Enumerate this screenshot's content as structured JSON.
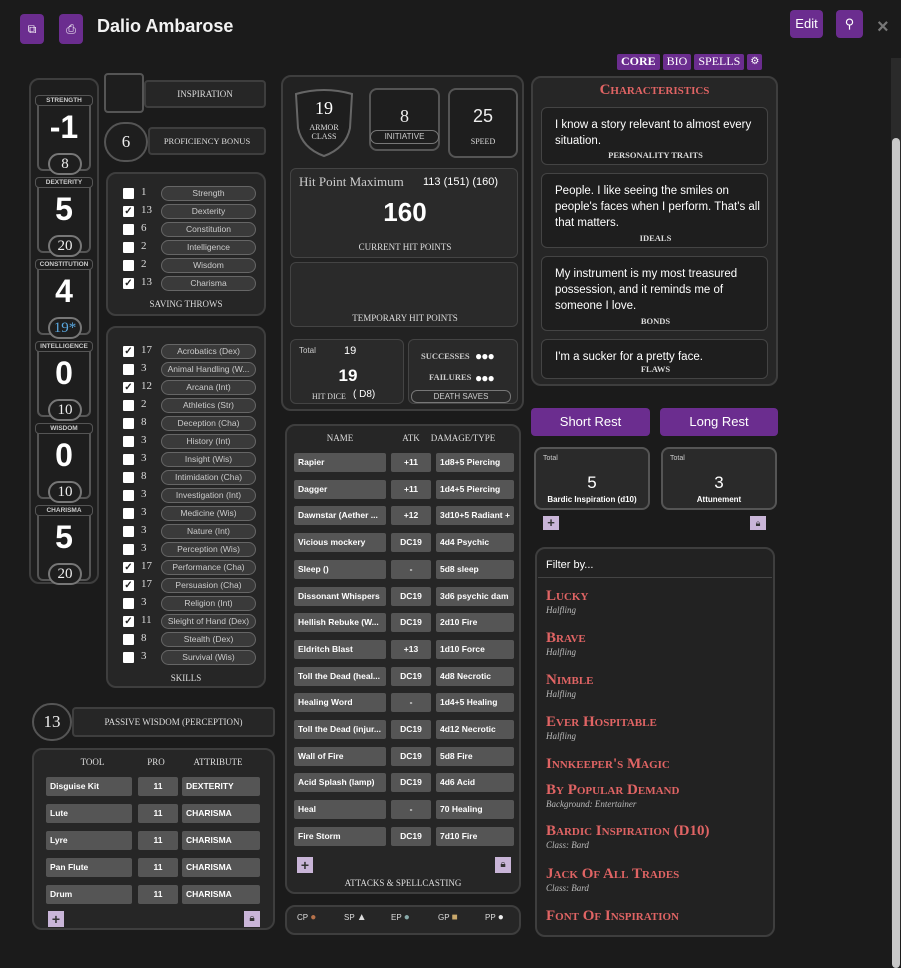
{
  "header": {
    "title": "Dalio Ambarose",
    "edit_label": "Edit",
    "close_glyph": "×"
  },
  "tabs": [
    {
      "label": "CORE"
    },
    {
      "label": "BIO"
    },
    {
      "label": "SPELLS"
    }
  ],
  "abilities": [
    {
      "name": "STRENGTH",
      "mod": "-1",
      "score": "8"
    },
    {
      "name": "DEXTERITY",
      "mod": "5",
      "score": "20"
    },
    {
      "name": "CONSTITUTION",
      "mod": "4",
      "score": "19*"
    },
    {
      "name": "INTELLIGENCE",
      "mod": "0",
      "score": "10"
    },
    {
      "name": "WISDOM",
      "mod": "0",
      "score": "10"
    },
    {
      "name": "CHARISMA",
      "mod": "5",
      "score": "20"
    }
  ],
  "inspiration": {
    "label": "INSPIRATION"
  },
  "proficiency": {
    "value": "6",
    "label": "PROFICIENCY BONUS"
  },
  "saving_throws": {
    "title": "SAVING THROWS",
    "items": [
      {
        "checked": false,
        "value": "1",
        "name": "Strength"
      },
      {
        "checked": true,
        "value": "13",
        "name": "Dexterity"
      },
      {
        "checked": false,
        "value": "6",
        "name": "Constitution"
      },
      {
        "checked": false,
        "value": "2",
        "name": "Intelligence"
      },
      {
        "checked": false,
        "value": "2",
        "name": "Wisdom"
      },
      {
        "checked": true,
        "value": "13",
        "name": "Charisma"
      }
    ]
  },
  "skills": {
    "title": "SKILLS",
    "items": [
      {
        "checked": true,
        "value": "17",
        "name": "Acrobatics (Dex)"
      },
      {
        "checked": false,
        "value": "3",
        "name": "Animal Handling (W..."
      },
      {
        "checked": true,
        "value": "12",
        "name": "Arcana (Int)"
      },
      {
        "checked": false,
        "value": "2",
        "name": "Athletics (Str)"
      },
      {
        "checked": false,
        "value": "8",
        "name": "Deception (Cha)"
      },
      {
        "checked": false,
        "value": "3",
        "name": "History (Int)"
      },
      {
        "checked": false,
        "value": "3",
        "name": "Insight (Wis)"
      },
      {
        "checked": false,
        "value": "8",
        "name": "Intimidation (Cha)"
      },
      {
        "checked": false,
        "value": "3",
        "name": "Investigation (Int)"
      },
      {
        "checked": false,
        "value": "3",
        "name": "Medicine (Wis)"
      },
      {
        "checked": false,
        "value": "3",
        "name": "Nature (Int)"
      },
      {
        "checked": false,
        "value": "3",
        "name": "Perception (Wis)"
      },
      {
        "checked": true,
        "value": "17",
        "name": "Performance (Cha)"
      },
      {
        "checked": true,
        "value": "17",
        "name": "Persuasion (Cha)"
      },
      {
        "checked": false,
        "value": "3",
        "name": "Religion (Int)"
      },
      {
        "checked": true,
        "value": "11",
        "name": "Sleight of Hand (Dex)"
      },
      {
        "checked": false,
        "value": "8",
        "name": "Stealth (Dex)"
      },
      {
        "checked": false,
        "value": "3",
        "name": "Survival (Wis)"
      }
    ]
  },
  "passive": {
    "value": "13",
    "label": "PASSIVE WISDOM (PERCEPTION)"
  },
  "tools": {
    "headers": [
      "TOOL",
      "PRO",
      "ATTRIBUTE"
    ],
    "rows": [
      {
        "name": "Disguise Kit",
        "pro": "11",
        "attr": "DEXTERITY"
      },
      {
        "name": "Lute",
        "pro": "11",
        "attr": "CHARISMA"
      },
      {
        "name": "Lyre",
        "pro": "11",
        "attr": "CHARISMA"
      },
      {
        "name": "Pan Flute",
        "pro": "11",
        "attr": "CHARISMA"
      },
      {
        "name": "Drum",
        "pro": "11",
        "attr": "CHARISMA"
      }
    ]
  },
  "combat": {
    "ac": "19",
    "ac_label": "ARMOR CLASS",
    "initiative": "8",
    "initiative_label": "INITIATIVE",
    "speed": "25",
    "speed_label": "SPEED"
  },
  "hp": {
    "max_label": "Hit Point Maximum",
    "max_value": "113 (151) (160)",
    "current": "160",
    "current_label": "CURRENT HIT POINTS",
    "temp_label": "TEMPORARY HIT POINTS"
  },
  "hit_dice": {
    "total_label": "Total",
    "total": "19",
    "value": "19",
    "die": "D8",
    "label": "HIT DICE"
  },
  "death_saves": {
    "successes": "SUCCESSES",
    "failures": "FAILURES",
    "label": "DEATH SAVES"
  },
  "attacks": {
    "headers": [
      "NAME",
      "ATK",
      "DAMAGE/TYPE"
    ],
    "title": "ATTACKS & SPELLCASTING",
    "rows": [
      {
        "name": "Rapier",
        "atk": "+11",
        "dmg": "1d8+5 Piercing"
      },
      {
        "name": "Dagger",
        "atk": "+11",
        "dmg": "1d4+5 Piercing"
      },
      {
        "name": "Dawnstar (Aether ...",
        "atk": "+12",
        "dmg": "3d10+5 Radiant +"
      },
      {
        "name": "Vicious mockery",
        "atk": "DC19",
        "dmg": "4d4 Psychic"
      },
      {
        "name": "Sleep ()",
        "atk": "-",
        "dmg": "5d8 sleep"
      },
      {
        "name": "Dissonant Whispers",
        "atk": "DC19",
        "dmg": "3d6 psychic dam"
      },
      {
        "name": "Hellish Rebuke (W...",
        "atk": "DC19",
        "dmg": "2d10 Fire"
      },
      {
        "name": "Eldritch Blast",
        "atk": "+13",
        "dmg": "1d10 Force"
      },
      {
        "name": "Toll the Dead (heal...",
        "atk": "DC19",
        "dmg": "4d8 Necrotic"
      },
      {
        "name": "Healing Word",
        "atk": "-",
        "dmg": "1d4+5 Healing"
      },
      {
        "name": "Toll the Dead (injur...",
        "atk": "DC19",
        "dmg": "4d12 Necrotic"
      },
      {
        "name": "Wall of Fire",
        "atk": "DC19",
        "dmg": "5d8 Fire"
      },
      {
        "name": "Acid Splash (lamp)",
        "atk": "DC19",
        "dmg": "4d6 Acid"
      },
      {
        "name": "Heal",
        "atk": "-",
        "dmg": "70 Healing"
      },
      {
        "name": "Fire Storm",
        "atk": "DC19",
        "dmg": "7d10 Fire"
      }
    ]
  },
  "coins": [
    "CP",
    "SP",
    "EP",
    "GP",
    "PP"
  ],
  "characteristics": {
    "title": "Characteristics",
    "items": [
      {
        "text": "I know a story relevant to almost every situation.",
        "label": "PERSONALITY TRAITS"
      },
      {
        "text": "People. I like seeing the smiles on people's faces when I perform. That's all that matters.",
        "label": "IDEALS"
      },
      {
        "text": "My instrument is my most treasured possession, and it reminds me of someone I love.",
        "label": "BONDS"
      },
      {
        "text": "I'm a sucker for a pretty face.",
        "label": "FLAWS"
      }
    ]
  },
  "rest": {
    "short": "Short Rest",
    "long": "Long Rest"
  },
  "resources": [
    {
      "total_label": "Total",
      "value": "5",
      "name": "Bardic Inspiration (d10)"
    },
    {
      "total_label": "Total",
      "value": "3",
      "name": "Attunement"
    }
  ],
  "features": {
    "filter": "Filter by...",
    "items": [
      {
        "title": "Lucky",
        "source": "Halfling"
      },
      {
        "title": "Brave",
        "source": "Halfling"
      },
      {
        "title": "Nimble",
        "source": "Halfling"
      },
      {
        "title": "Ever Hospitable",
        "source": "Halfling"
      },
      {
        "title": "Innkeeper's Magic",
        "source": ""
      },
      {
        "title": "By Popular Demand",
        "source": "Background: Entertainer"
      },
      {
        "title": "Bardic Inspiration (D10)",
        "source": "Class: Bard"
      },
      {
        "title": "Jack Of All Trades",
        "source": "Class: Bard"
      },
      {
        "title": "Font Of Inspiration",
        "source": ""
      }
    ]
  },
  "colors": {
    "accent": "#6b2d8f",
    "feature": "#e06464",
    "panel": "#262626"
  }
}
